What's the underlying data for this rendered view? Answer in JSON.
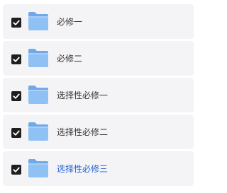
{
  "items": [
    {
      "label": "必修一",
      "checked": true
    },
    {
      "label": "必修二",
      "checked": true
    },
    {
      "label": "选择性必修一",
      "checked": true
    },
    {
      "label": "选择性必修二",
      "checked": true
    },
    {
      "label": "选择性必修三",
      "checked": true
    }
  ],
  "icons": {
    "checkbox": "checkbox-checked-icon",
    "folder": "folder-icon"
  },
  "colors": {
    "row_background": "#f4f4f6",
    "checkbox_fill": "#1e1e1e",
    "folder_fill": "#8fc1f4",
    "text": "#333333",
    "highlight_text": "#1f5fd0"
  }
}
